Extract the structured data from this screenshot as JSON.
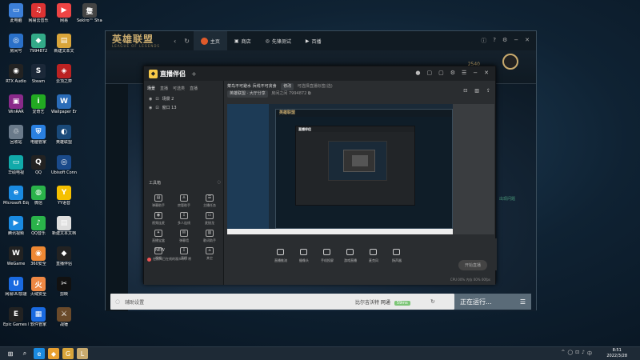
{
  "desktop": {
    "icons": [
      {
        "label": "此电脑",
        "color": "#3c7fd8",
        "glyph": "▭"
      },
      {
        "label": "网易云音乐",
        "color": "#d33",
        "glyph": "♫"
      },
      {
        "label": "网易",
        "color": "#e44",
        "glyph": "▶"
      },
      {
        "label": "Sekiro™ Shadows",
        "color": "#444",
        "glyph": "隻"
      },
      {
        "label": "房间号",
        "color": "#2a70c8",
        "glyph": "◎"
      },
      {
        "label": "7994872",
        "color": "#3a8",
        "glyph": "◆"
      },
      {
        "label": "新建文本文",
        "color": "#d9a53a",
        "glyph": "▤"
      },
      {
        "label": "RTX Audio",
        "color": "#222",
        "glyph": "◉"
      },
      {
        "label": "Steam",
        "color": "#1b2838",
        "glyph": "S"
      },
      {
        "label": "云顶之弈",
        "color": "#b22",
        "glyph": "◈"
      },
      {
        "label": "WinRAR",
        "color": "#8a2a8a",
        "glyph": "▣"
      },
      {
        "label": "爱奇艺",
        "color": "#2a2",
        "glyph": "i"
      },
      {
        "label": "Wallpaper Engine",
        "color": "#2a6cb8",
        "glyph": "W"
      },
      {
        "label": "回收站",
        "color": "#6a7a8a",
        "glyph": "♲"
      },
      {
        "label": "电脑管家",
        "color": "#2a80e0",
        "glyph": "⛨"
      },
      {
        "label": "英雄联盟",
        "color": "#1a4a7a",
        "glyph": "◐"
      },
      {
        "label": "华硕电视",
        "color": "#1aa",
        "glyph": "▭"
      },
      {
        "label": "QQ",
        "color": "#222",
        "glyph": "Q"
      },
      {
        "label": "Ubisoft Connect",
        "color": "#1a4a8a",
        "glyph": "◎"
      },
      {
        "label": "Microsoft Edge",
        "color": "#1a8ae0",
        "glyph": "e"
      },
      {
        "label": "微信",
        "color": "#2ab34a",
        "glyph": "◍"
      },
      {
        "label": "YY语音",
        "color": "#f5c000",
        "glyph": "Y"
      },
      {
        "label": "腾讯视频",
        "color": "#1a8ae0",
        "glyph": "▶"
      },
      {
        "label": "QQ音乐",
        "color": "#2ab34a",
        "glyph": "♪"
      },
      {
        "label": "新建文本文档",
        "color": "#ddd",
        "glyph": "▤"
      },
      {
        "label": "WeGame",
        "color": "#222",
        "glyph": "W"
      },
      {
        "label": "360安全",
        "color": "#e83",
        "glyph": "◉"
      },
      {
        "label": "直播伴侣",
        "color": "#222",
        "glyph": "◆"
      },
      {
        "label": "网易UU加速",
        "color": "#1a6ae0",
        "glyph": "U"
      },
      {
        "label": "火绒安全",
        "color": "#e84",
        "glyph": "火"
      },
      {
        "label": "剪映",
        "color": "#111",
        "glyph": "✂"
      },
      {
        "label": "Epic Games Launcher",
        "color": "#222",
        "glyph": "E"
      },
      {
        "label": "软件管家",
        "color": "#1a6ae0",
        "glyph": "▦"
      },
      {
        "label": "战锤",
        "color": "#6a4a2a",
        "glyph": "⚔"
      }
    ]
  },
  "taskbar": {
    "items": [
      "⊞",
      "⌕",
      "e",
      "◆",
      "G",
      "L"
    ],
    "tray": [
      "^",
      "◯",
      "⊡",
      "♪",
      "中"
    ],
    "time": "8:51",
    "date": "2022/3/28"
  },
  "lol": {
    "title_cn": "英雄联盟",
    "title_en": "LEAGUE OF LEGENDS",
    "tabs": [
      {
        "label": "主页",
        "active": true
      },
      {
        "label": "商店",
        "active": false
      },
      {
        "label": "先锋测试",
        "active": false
      },
      {
        "label": "百播",
        "active": false
      }
    ],
    "currency": "2540",
    "assistant": "辅助设置",
    "match_text": "比尔吉沃特 网通",
    "ping": "59ms",
    "status": "正在运行...",
    "feed": "出现问题"
  },
  "zb": {
    "title": "直播伴侣",
    "tabs": [
      "场景",
      "直播",
      "可选类",
      "直播"
    ],
    "scenes": [
      {
        "label": "场景 2"
      },
      {
        "label": "窗口 13"
      }
    ],
    "toolbox_label": "工具箱",
    "tools": [
      {
        "label": "弹幕助手",
        "glyph": "▤"
      },
      {
        "label": "房管助手",
        "glyph": "♙"
      },
      {
        "label": "主播任务",
        "glyph": "☰"
      },
      {
        "label": "视频连麦",
        "glyph": "◉"
      },
      {
        "label": "多人连线",
        "glyph": "⇩"
      },
      {
        "label": "麦接龙",
        "glyph": "▭"
      },
      {
        "label": "直播宝盒",
        "glyph": "✦"
      },
      {
        "label": "弹幕墙",
        "glyph": "✉"
      },
      {
        "label": "歌词助手",
        "glyph": "▥"
      },
      {
        "label": "视频",
        "glyph": "NEW"
      },
      {
        "label": "直播",
        "glyph": "⇩"
      },
      {
        "label": "其它",
        "glyph": "⌂"
      }
    ],
    "tip": "在房间已在线的观众中，将",
    "stream_title": "菜鸟不可避水 兵线不可贪食",
    "edit_tag": "修改",
    "hot_label": "可选择直播标签(选)",
    "category": "英雄联盟 · 大厅分享",
    "room_label": "房间之间",
    "room_id": "7994872",
    "bottom_tools": [
      {
        "label": "直播推流"
      },
      {
        "label": "摄像头"
      },
      {
        "label": "手机投屏"
      },
      {
        "label": "游戏直播"
      },
      {
        "label": "麦克风"
      },
      {
        "label": "扬声器"
      }
    ],
    "start_button": "开始直播",
    "stats": "CPU 00%  内存 00%  00fps"
  }
}
